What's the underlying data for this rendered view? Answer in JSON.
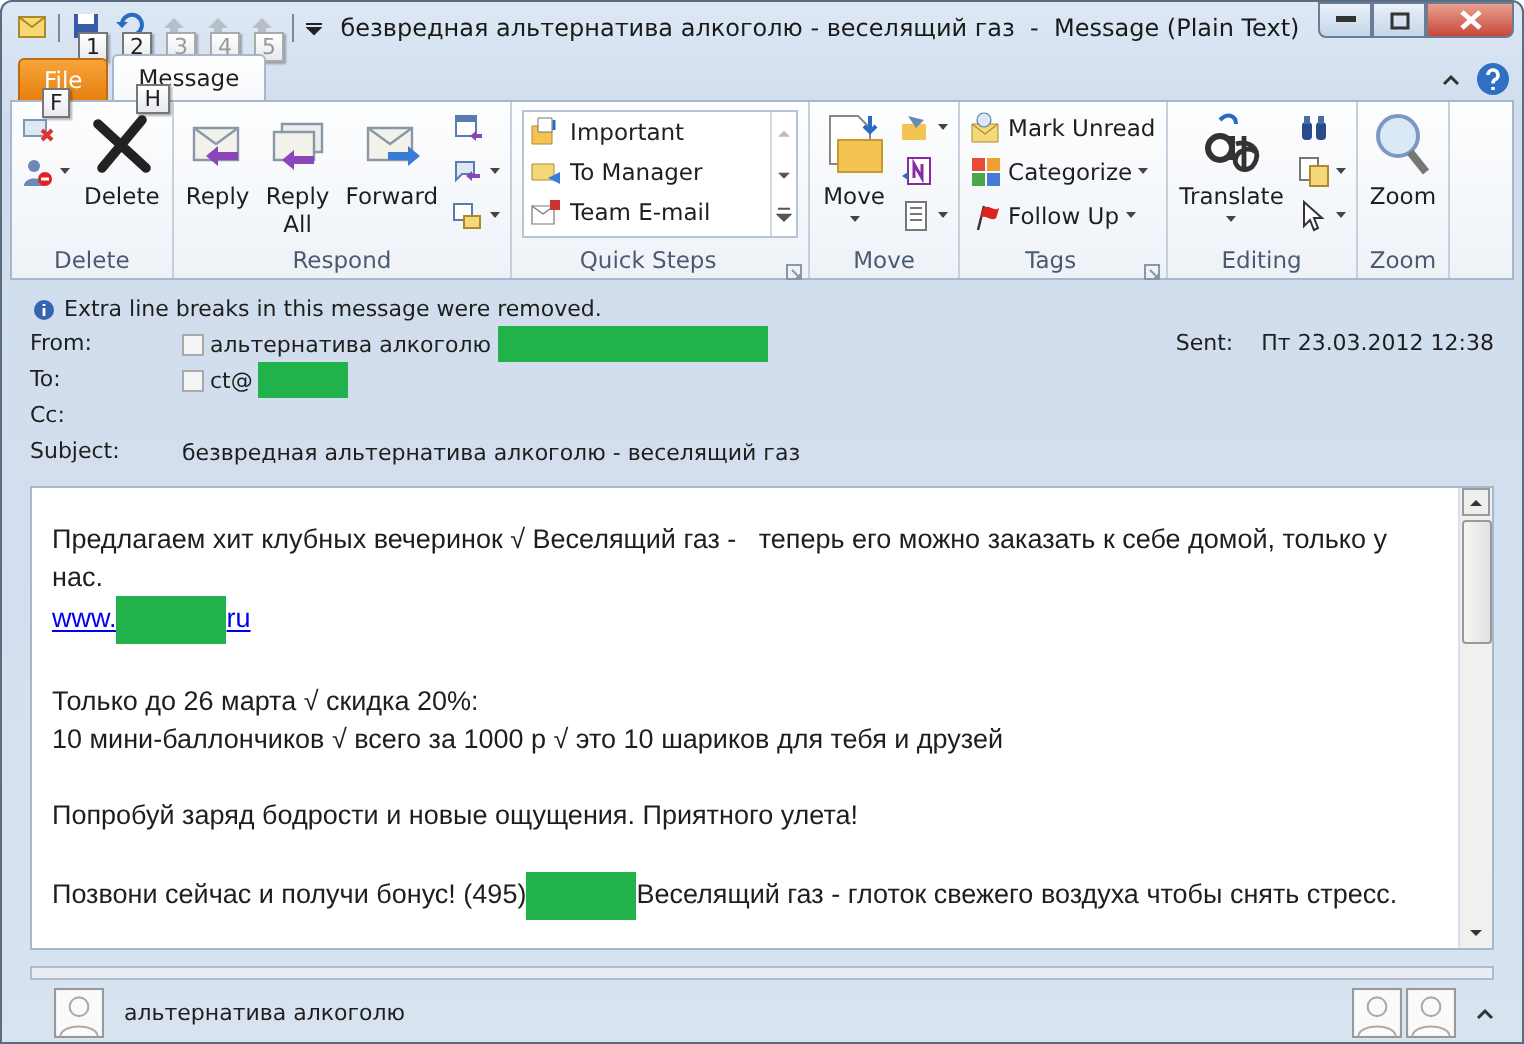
{
  "title_bar": {
    "quick_access": [
      {
        "keytip": "1",
        "disabled": false
      },
      {
        "keytip": "2",
        "disabled": false
      },
      {
        "keytip": "3",
        "disabled": true
      },
      {
        "keytip": "4",
        "disabled": true
      },
      {
        "keytip": "5",
        "disabled": true
      }
    ],
    "title": "безвредная альтернатива алкоголю - веселящий газ  -  Message (Plain Text)"
  },
  "tabs": [
    {
      "label": "File",
      "kind": "file",
      "keytip": "F",
      "selected": false
    },
    {
      "label": "Message",
      "kind": "tab",
      "keytip": "H",
      "selected": true
    }
  ],
  "ribbon": {
    "groups": [
      {
        "label": "Delete",
        "launcher": false,
        "controls": [
          {
            "kind": "column",
            "items": [
              {
                "dropdown": false
              },
              {
                "dropdown": true
              }
            ]
          },
          {
            "kind": "large",
            "label": "Delete",
            "dropdown": false
          }
        ]
      },
      {
        "label": "Respond",
        "launcher": false,
        "controls": [
          {
            "kind": "large",
            "label": "Reply",
            "dropdown": false
          },
          {
            "kind": "large",
            "label": "Reply All",
            "dropdown": false
          },
          {
            "kind": "large",
            "label": "Forward",
            "dropdown": false
          },
          {
            "kind": "column",
            "items": [
              {
                "dropdown": false
              },
              {
                "dropdown": true
              },
              {
                "dropdown": true
              }
            ]
          }
        ]
      },
      {
        "label": "Quick Steps",
        "launcher": true,
        "controls": [
          {
            "kind": "gallery",
            "items": [
              {
                "label": "Important"
              },
              {
                "label": "To Manager"
              },
              {
                "label": "Team E-mail"
              }
            ]
          }
        ]
      },
      {
        "label": "Move",
        "launcher": false,
        "controls": [
          {
            "kind": "large",
            "label": "Move",
            "dropdown": true
          },
          {
            "kind": "column",
            "items": [
              {
                "dropdown": true
              },
              {
                "dropdown": false
              },
              {
                "dropdown": true
              }
            ]
          }
        ]
      },
      {
        "label": "Tags",
        "launcher": true,
        "controls": [
          {
            "kind": "column",
            "items": [
              {
                "label": "Mark Unread",
                "dropdown": false
              },
              {
                "label": "Categorize",
                "dropdown": true
              },
              {
                "label": "Follow Up",
                "dropdown": true
              }
            ]
          }
        ]
      },
      {
        "label": "Editing",
        "launcher": false,
        "controls": [
          {
            "kind": "large",
            "label": "Translate",
            "dropdown": true
          },
          {
            "kind": "column",
            "items": [
              {
                "dropdown": false
              },
              {
                "dropdown": true
              },
              {
                "dropdown": true
              }
            ]
          }
        ]
      },
      {
        "label": "Zoom",
        "launcher": false,
        "controls": [
          {
            "kind": "large",
            "label": "Zoom",
            "dropdown": false
          }
        ]
      }
    ]
  },
  "info_bar": "Extra line breaks in this message were removed.",
  "header": {
    "fields": [
      {
        "label": "From:",
        "checked": false,
        "value": "альтернатива алкоголю",
        "redacted": true
      },
      {
        "label": "To:",
        "checked": false,
        "value": "ct@",
        "redacted": true
      },
      {
        "label": "Cc:"
      },
      {
        "label": "Subject:",
        "value": "безвредная альтернатива алкоголю - веселящий газ"
      }
    ],
    "sent_label": "Sent:",
    "sent_value": "Пт 23.03.2012 12:38"
  },
  "body": {
    "paragraphs": [
      [
        [
          {
            "kind": "text",
            "text": "Предлагаем хит клубных вечеринок √ Веселящий газ -   теперь его можно заказать к себе домой, только у нас."
          }
        ],
        [
          {
            "kind": "link",
            "text": "www."
          },
          {
            "kind": "redaction"
          },
          {
            "kind": "link",
            "text": "ru"
          }
        ]
      ],
      [
        [
          {
            "kind": "text",
            "text": "Только до 26 марта √ скидка 20%:"
          }
        ],
        [
          {
            "kind": "text",
            "text": "10 мини-баллончиков √ всего за 1000 р √ это 10 шариков для тебя и друзей"
          }
        ]
      ],
      [
        [
          {
            "kind": "text",
            "text": "Попробуй заряд бодрости и новые ощущения. Приятного улета!"
          }
        ]
      ],
      [
        [
          {
            "kind": "text",
            "text": "Позвони сейчас и получи бонус! (495)"
          },
          {
            "kind": "redaction"
          },
          {
            "kind": "text",
            "text": "Веселящий газ - глоток свежего воздуха чтобы снять стресс."
          }
        ]
      ]
    ]
  },
  "people_pane": {
    "name": "альтернатива алкоголю"
  }
}
